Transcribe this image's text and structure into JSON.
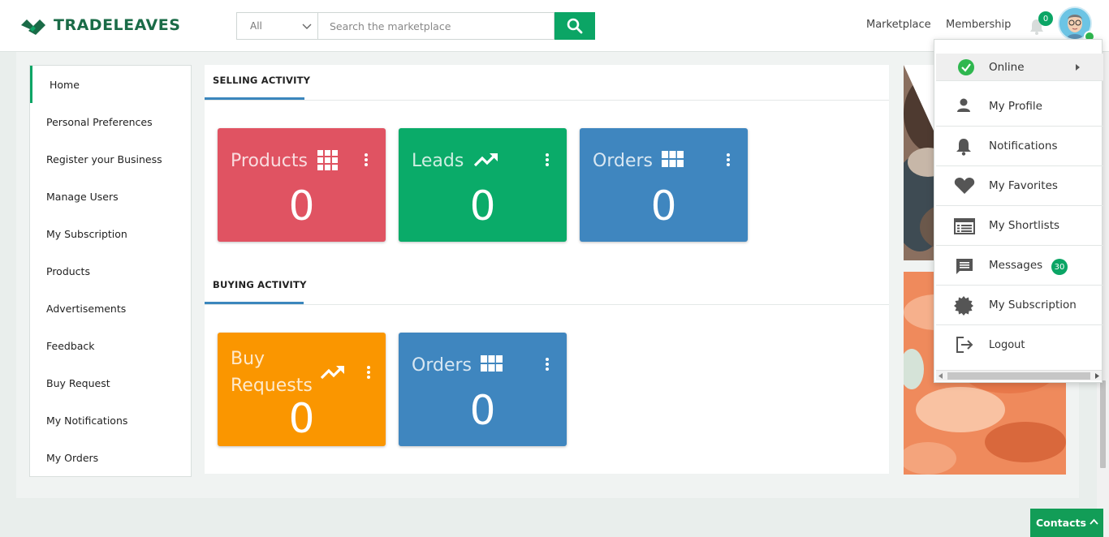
{
  "brand": {
    "name": "TRADELEAVES"
  },
  "search": {
    "category": "All",
    "placeholder": "Search the marketplace"
  },
  "nav": {
    "marketplace": "Marketplace",
    "membership": "Membership",
    "notification_count": "0"
  },
  "sidebar": {
    "items": [
      {
        "label": "Home"
      },
      {
        "label": "Personal Preferences"
      },
      {
        "label": "Register your Business"
      },
      {
        "label": "Manage Users"
      },
      {
        "label": "My Subscription"
      },
      {
        "label": "Products"
      },
      {
        "label": "Advertisements"
      },
      {
        "label": "Feedback"
      },
      {
        "label": "Buy Request"
      },
      {
        "label": "My Notifications"
      },
      {
        "label": "My Orders"
      }
    ]
  },
  "selling": {
    "title": "SELLING ACTIVITY",
    "cards": [
      {
        "title": "Products",
        "count": "0",
        "color": "#e05362",
        "icon": "grid-icon"
      },
      {
        "title": "Leads",
        "count": "0",
        "color": "#0aab69",
        "icon": "trending-up-icon"
      },
      {
        "title": "Orders",
        "count": "0",
        "color": "#3f86bf",
        "icon": "table-icon"
      }
    ]
  },
  "buying": {
    "title": "BUYING ACTIVITY",
    "cards": [
      {
        "title": "Buy Requests",
        "count": "0",
        "color": "#fa9600",
        "icon": "trending-up-icon"
      },
      {
        "title": "Orders",
        "count": "0",
        "color": "#3f86bf",
        "icon": "table-icon"
      }
    ]
  },
  "user_menu": {
    "status": "Online",
    "items": [
      {
        "label": "My Profile",
        "icon": "person-icon"
      },
      {
        "label": "Notifications",
        "icon": "bell-icon"
      },
      {
        "label": "My Favorites",
        "icon": "heart-icon"
      },
      {
        "label": "My Shortlists",
        "icon": "list-icon"
      },
      {
        "label": "Messages",
        "icon": "message-icon"
      },
      {
        "label": "My Subscription",
        "icon": "badge-icon"
      },
      {
        "label": "Logout",
        "icon": "logout-icon"
      }
    ],
    "messages_count": "30"
  },
  "contacts": {
    "label": "Contacts"
  }
}
